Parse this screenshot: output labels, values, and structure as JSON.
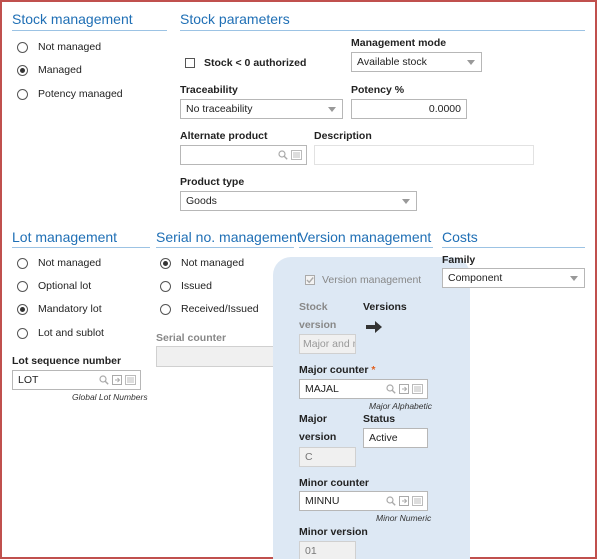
{
  "stock_management": {
    "title": "Stock management",
    "options": [
      {
        "label": "Not managed",
        "selected": false
      },
      {
        "label": "Managed",
        "selected": true
      },
      {
        "label": "Potency managed",
        "selected": false
      }
    ]
  },
  "stock_parameters": {
    "title": "Stock parameters",
    "stock_negative_label": "Stock < 0 authorized",
    "stock_negative_checked": false,
    "management_mode_label": "Management mode",
    "management_mode_value": "Available stock",
    "traceability_label": "Traceability",
    "traceability_value": "No traceability",
    "potency_label": "Potency %",
    "potency_value": "0.0000",
    "alternate_product_label": "Alternate product",
    "alternate_product_value": "",
    "description_label": "Description",
    "description_value": "",
    "product_type_label": "Product type",
    "product_type_value": "Goods"
  },
  "lot_management": {
    "title": "Lot management",
    "options": [
      {
        "label": "Not managed",
        "selected": false
      },
      {
        "label": "Optional lot",
        "selected": false
      },
      {
        "label": "Mandatory lot",
        "selected": true
      },
      {
        "label": "Lot and sublot",
        "selected": false
      }
    ],
    "sequence_label": "Lot sequence number",
    "sequence_value": "LOT",
    "sequence_hint": "Global Lot Numbers"
  },
  "serial_management": {
    "title": "Serial no. management",
    "options": [
      {
        "label": "Not managed",
        "selected": true
      },
      {
        "label": "Issued",
        "selected": false
      },
      {
        "label": "Received/Issued",
        "selected": false
      }
    ],
    "counter_label": "Serial counter",
    "counter_value": ""
  },
  "version_management": {
    "title": "Version management",
    "checkbox_label": "Version management",
    "checkbox_checked": true,
    "stock_version_label_1": "Stock",
    "stock_version_label_2": "version",
    "stock_version_value": "Major and m",
    "versions_label": "Versions",
    "major_counter_label": "Major counter",
    "major_counter_required": "*",
    "major_counter_value": "MAJAL",
    "major_counter_hint": "Major Alphabetic",
    "major_version_label_1": "Major",
    "major_version_label_2": "version",
    "major_version_value": "C",
    "status_label": "Status",
    "status_value": "Active",
    "minor_counter_label": "Minor counter",
    "minor_counter_value": "MINNU",
    "minor_counter_hint": "Minor Numeric",
    "minor_version_label": "Minor version",
    "minor_version_value": "01"
  },
  "costs": {
    "title": "Costs",
    "family_label": "Family",
    "family_value": "Component"
  },
  "colors": {
    "section_title": "#1f6fb5",
    "frame_border": "#c0504d",
    "panel_bg": "#dde8f4",
    "required": "#e06020"
  }
}
